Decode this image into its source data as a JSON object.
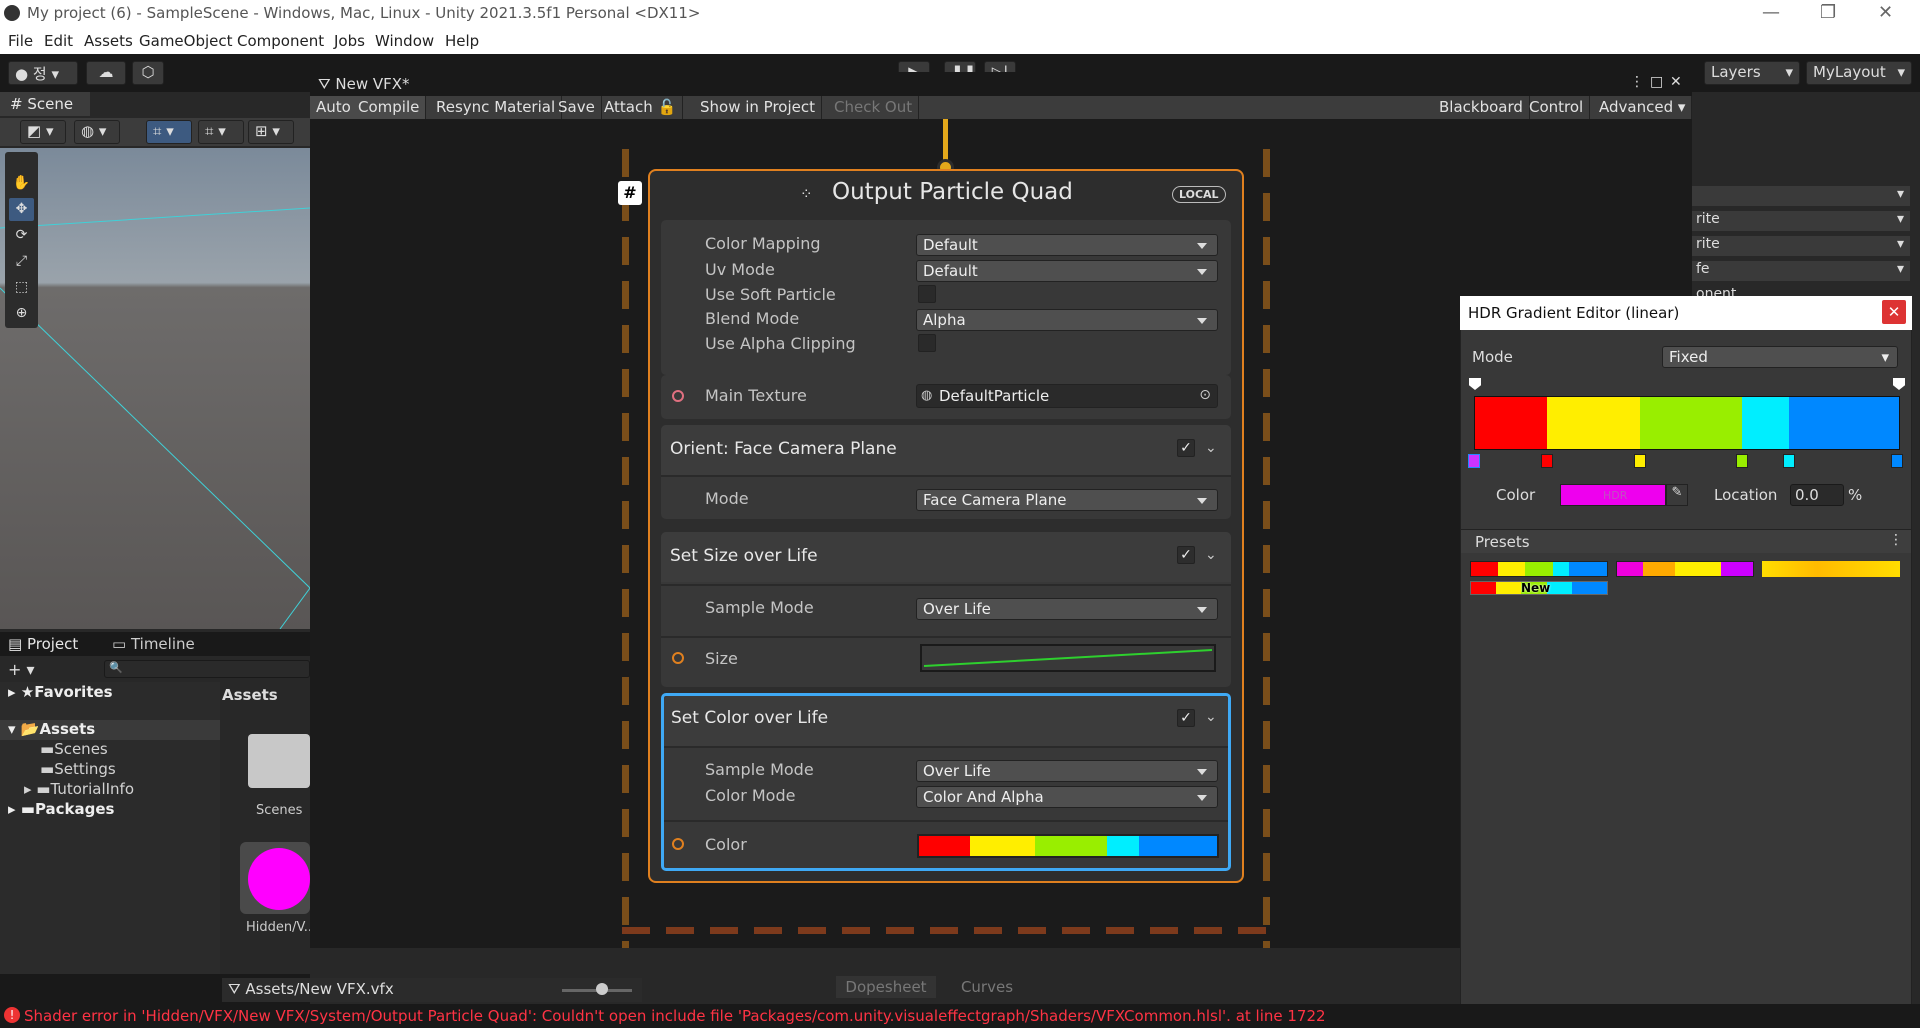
{
  "window": {
    "title": "My project (6) - SampleScene - Windows, Mac, Linux - Unity 2021.3.5f1 Personal <DX11>"
  },
  "menu": [
    "File",
    "Edit",
    "Assets",
    "GameObject",
    "Component",
    "Jobs",
    "Window",
    "Help"
  ],
  "toolbar": {
    "account_label": "정",
    "layers_label": "Layers",
    "layout_label": "MyLayout"
  },
  "scene": {
    "tab_label": "Scene"
  },
  "project": {
    "tab_project": "Project",
    "tab_timeline": "Timeline",
    "tree": {
      "favorites": "Favorites",
      "assets": "Assets",
      "scenes": "Scenes",
      "settings": "Settings",
      "tutorialinfo": "TutorialInfo",
      "packages": "Packages"
    },
    "assets_header": "Assets",
    "folder_label": "Scenes",
    "item_label": "Hidden/V...",
    "path": "Assets/New VFX.vfx"
  },
  "vfx": {
    "tab_title": "New VFX*",
    "toolbar": {
      "auto": "Auto",
      "compile": "Compile",
      "resync": "Resync Material",
      "save": "Save",
      "attach": "Attach",
      "show_in_project": "Show in Project",
      "check_out": "Check Out",
      "blackboard": "Blackboard",
      "control": "Control",
      "advanced": "Advanced"
    },
    "node": {
      "title": "Output Particle Quad",
      "badge": "LOCAL",
      "settings": {
        "color_mapping_label": "Color Mapping",
        "color_mapping_value": "Default",
        "uv_mode_label": "Uv Mode",
        "uv_mode_value": "Default",
        "soft_particle_label": "Use Soft Particle",
        "blend_mode_label": "Blend Mode",
        "blend_mode_value": "Alpha",
        "alpha_clipping_label": "Use Alpha Clipping",
        "main_texture_label": "Main Texture",
        "main_texture_value": "DefaultParticle"
      },
      "orient": {
        "title": "Orient: Face Camera Plane",
        "mode_label": "Mode",
        "mode_value": "Face Camera Plane"
      },
      "size": {
        "title": "Set Size over Life",
        "sample_mode_label": "Sample Mode",
        "sample_mode_value": "Over Life",
        "size_label": "Size"
      },
      "color": {
        "title": "Set Color over Life",
        "sample_mode_label": "Sample Mode",
        "sample_mode_value": "Over Life",
        "color_mode_label": "Color Mode",
        "color_mode_value": "Color And Alpha",
        "color_label": "Color"
      }
    },
    "bottom": {
      "dopesheet": "Dopesheet",
      "curves": "Curves"
    }
  },
  "gradient_editor": {
    "title": "HDR Gradient Editor (linear)",
    "mode_label": "Mode",
    "mode_value": "Fixed",
    "color_label": "Color",
    "color_value": "HDR",
    "location_label": "Location",
    "location_value": "0.0",
    "location_unit": "%",
    "presets_label": "Presets",
    "new_label": "New",
    "colors": {
      "red": "#ff0000",
      "yellow": "#ffee00",
      "green": "#99ee00",
      "cyan": "#00eeff",
      "blue": "#0088ff",
      "magenta": "#ee00ee"
    }
  },
  "inspector": {
    "rows": [
      "rite",
      "rite",
      "fe",
      "onent"
    ]
  },
  "status": {
    "error": "Shader error in 'Hidden/VFX/New VFX/System/Output Particle Quad': Couldn't open include file 'Packages/com.unity.visualeffectgraph/Shaders/VFXCommon.hlsl'. at line 1722"
  }
}
